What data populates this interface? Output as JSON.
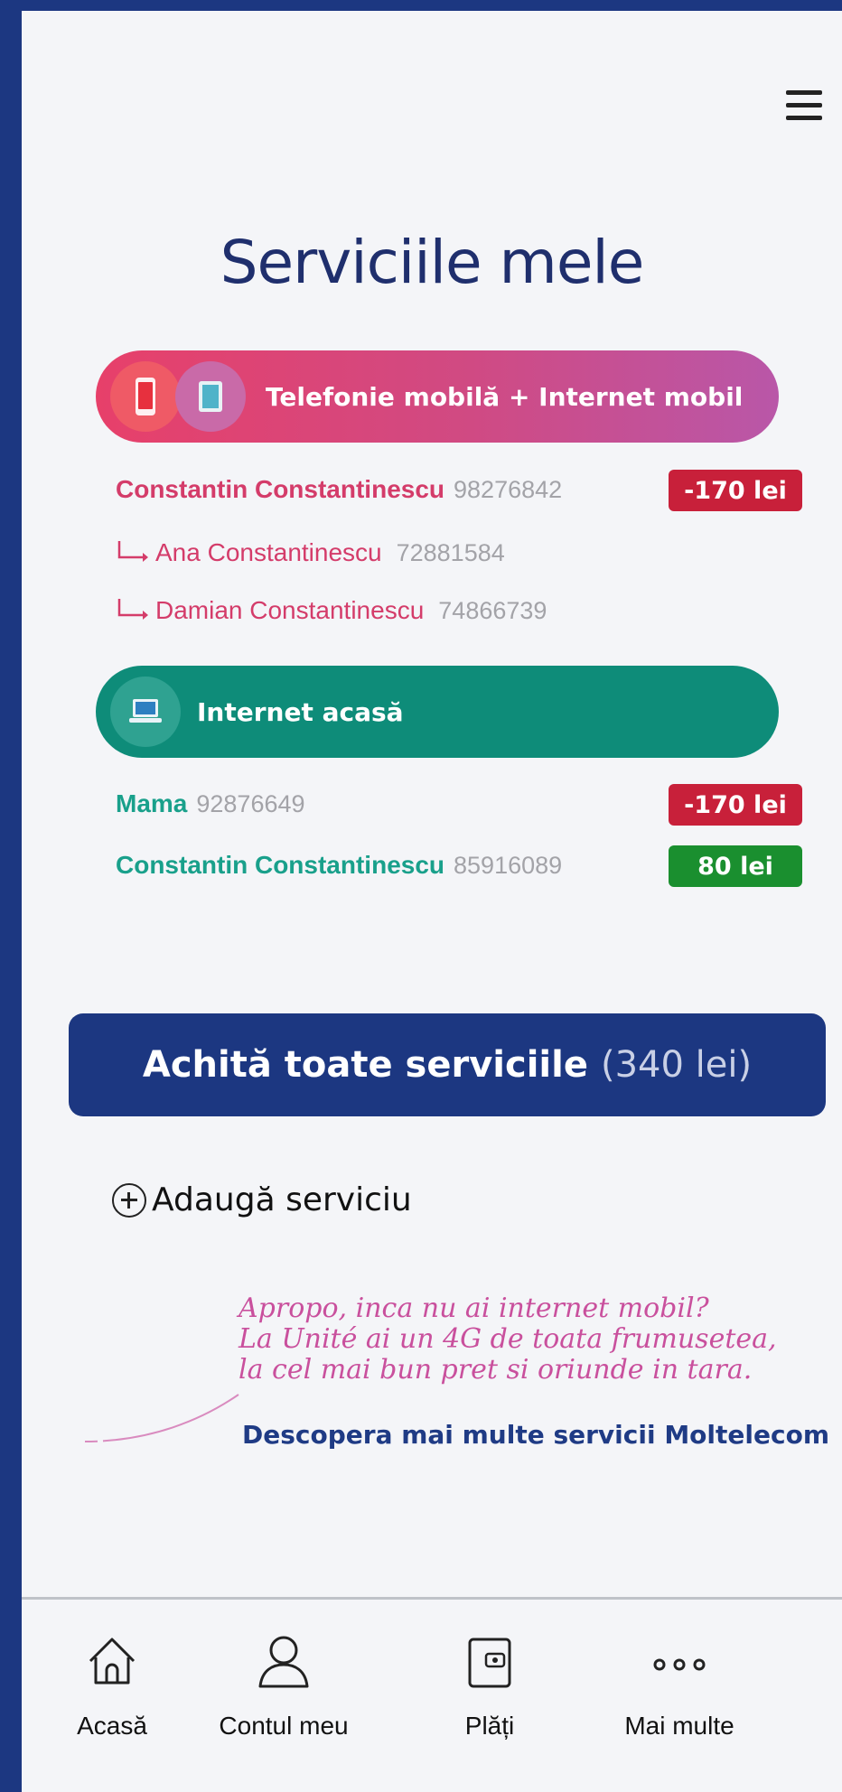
{
  "header": {
    "title": "Serviciile mele",
    "menu_icon": "hamburger-menu-icon"
  },
  "mobile_section": {
    "label": "Telefonie mobilă + Internet mobil",
    "icons": [
      "phone-icon",
      "tablet-icon"
    ],
    "colors": {
      "gradient_start": "#e7406a",
      "gradient_end": "#b957a8"
    },
    "accounts": [
      {
        "name": "Constantin Constantinescu",
        "number": "98276842",
        "balance": "-170 lei",
        "balance_status": "negative"
      },
      {
        "name": "Ana Constantinescu",
        "number": "72881584",
        "sub_account": true
      },
      {
        "name": "Damian Constantinescu",
        "number": "74866739",
        "sub_account": true
      }
    ]
  },
  "home_section": {
    "label": "Internet acasă",
    "icon": "laptop-icon",
    "color": "#0e8c79",
    "accounts": [
      {
        "name": "Mama",
        "number": "92876649",
        "balance": "-170 lei",
        "balance_status": "negative"
      },
      {
        "name": "Constantin Constantinescu",
        "number": "85916089",
        "balance": "80 lei",
        "balance_status": "positive"
      }
    ]
  },
  "pay_all": {
    "label": "Achită toate serviciile",
    "amount": "(340 lei)"
  },
  "add_service": {
    "label": "Adaugă serviciu",
    "icon": "plus-circle-icon"
  },
  "promo": {
    "lines": [
      "Apropo, inca nu ai internet mobil?",
      "La Unité ai un 4G de toata frumusetea,",
      "la cel mai bun pret si oriunde in tara."
    ],
    "link": "Descopera mai multe servicii Moltelecom"
  },
  "bottom_nav": [
    {
      "label": "Acasă",
      "icon": "home-icon"
    },
    {
      "label": "Contul meu",
      "icon": "user-icon"
    },
    {
      "label": "Plăți",
      "icon": "wallet-icon"
    },
    {
      "label": "Mai multe",
      "icon": "more-dots-icon"
    }
  ],
  "colors": {
    "primary": "#1c3781",
    "negative": "#c8203a",
    "positive": "#1a8f2f",
    "mobile_accent": "#d43c6a",
    "home_accent": "#19a08b"
  }
}
